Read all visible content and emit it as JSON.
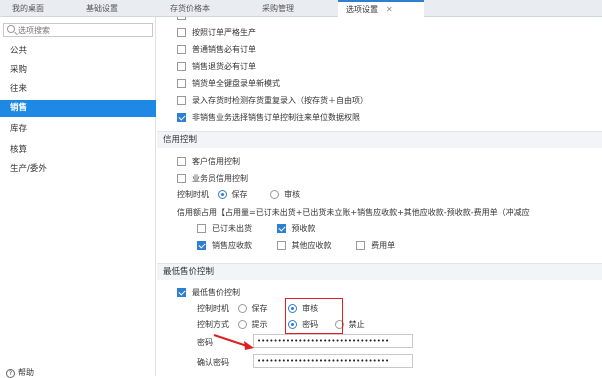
{
  "tabs": [
    {
      "label": "我的桌面"
    },
    {
      "label": "基础设置"
    },
    {
      "label": "存货价格本"
    },
    {
      "label": "采购管理"
    },
    {
      "label": "选项设置"
    }
  ],
  "sidebar": {
    "search_placeholder": "选项搜索",
    "items": [
      {
        "label": "公共"
      },
      {
        "label": "采购"
      },
      {
        "label": "往来"
      },
      {
        "label": "销售"
      },
      {
        "label": "库存"
      },
      {
        "label": "核算"
      },
      {
        "label": "生产/委外"
      }
    ],
    "help_label": "帮助"
  },
  "options_top": [
    {
      "label": "按照订单严格生产",
      "checked": false
    },
    {
      "label": "普通销售必有订单",
      "checked": false
    },
    {
      "label": "销售退货必有订单",
      "checked": false
    },
    {
      "label": "销货单全键盘录单新模式",
      "checked": false
    },
    {
      "label": "录入存货时检测存货重复录入（按存货＋自由项）",
      "checked": false
    },
    {
      "label": "非销售业务选择销售订单控制往来单位数据权限",
      "checked": true
    }
  ],
  "credit": {
    "title": "信用控制",
    "customer_credit": "客户信用控制",
    "salesman_credit": "业务员信用控制",
    "timing_label": "控制时机",
    "timing_save": "保存",
    "timing_audit": "审核",
    "formula": "信用额占用【占用量=已订未出货+已出货未立账+销售应收款+其他应收款-预收款-费用单（冲减应",
    "items": [
      {
        "label": "已订未出货",
        "checked": false
      },
      {
        "label": "预收款",
        "checked": true
      },
      {
        "label": "销售应收款",
        "checked": true
      },
      {
        "label": "其他应收款",
        "checked": false
      },
      {
        "label": "费用单",
        "checked": false
      }
    ]
  },
  "min_price": {
    "title": "最低售价控制",
    "enable_label": "最低售价控制",
    "timing_label": "控制时机",
    "timing_save": "保存",
    "timing_audit": "审核",
    "method_label": "控制方式",
    "method_prompt": "提示",
    "method_password": "密码",
    "method_forbid": "禁止",
    "password_label": "密码",
    "password_value": "••••••••••••••••••••••••••••••••",
    "confirm_label": "确认密码",
    "confirm_value": "••••••••••••••••••••••••••••••••"
  },
  "colors": {
    "accent": "#1e88e5",
    "highlight_box": "#e02020"
  }
}
